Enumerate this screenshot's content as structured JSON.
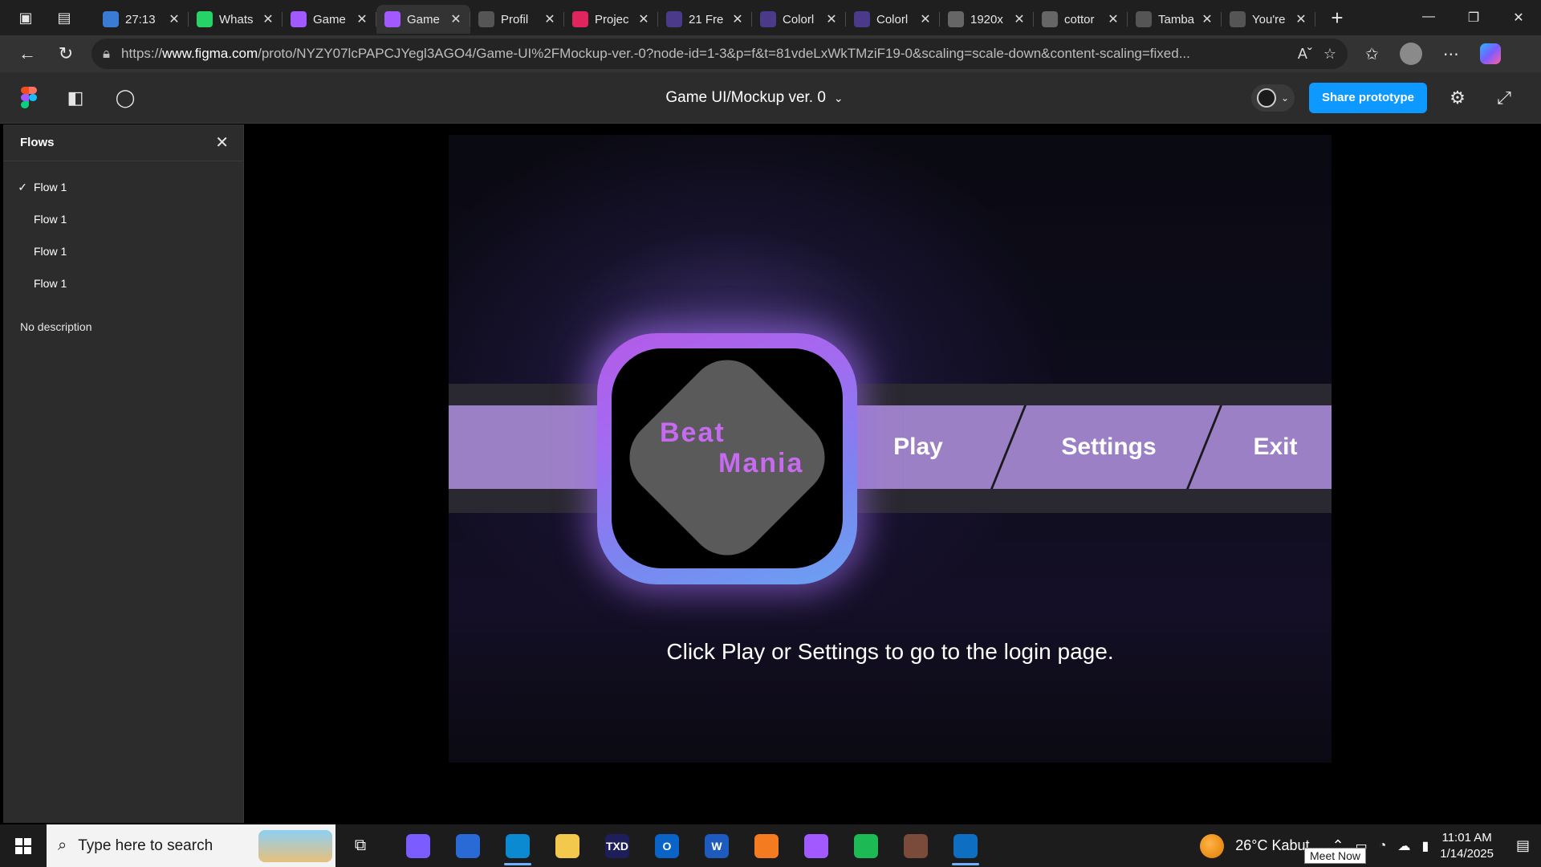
{
  "browser": {
    "tabs": [
      {
        "title": "27:13",
        "fav_color": "#3a7bd5",
        "icon": "timer-icon"
      },
      {
        "title": "Whats",
        "fav_color": "#25d366",
        "icon": "whatsapp-icon"
      },
      {
        "title": "Game",
        "fav_color": "#a259ff",
        "icon": "figma-icon"
      },
      {
        "title": "Game",
        "fav_color": "#a259ff",
        "icon": "figma-icon",
        "active": true
      },
      {
        "title": "Profil",
        "fav_color": "#555555",
        "icon": "globe-icon"
      },
      {
        "title": "Projec",
        "fav_color": "#e0245e",
        "icon": "triangle-icon"
      },
      {
        "title": "21 Fre",
        "fav_color": "#4b3a8a",
        "icon": "site-icon"
      },
      {
        "title": "Colorl",
        "fav_color": "#4b3a8a",
        "icon": "site-icon"
      },
      {
        "title": "Colorl",
        "fav_color": "#4b3a8a",
        "icon": "site-icon"
      },
      {
        "title": "1920x",
        "fav_color": "#666666",
        "icon": "site-icon"
      },
      {
        "title": "cottor",
        "fav_color": "#666666",
        "icon": "site-icon"
      },
      {
        "title": "Tamba",
        "fav_color": "#555555",
        "icon": "openai-icon"
      },
      {
        "title": "You're",
        "fav_color": "#555555",
        "icon": "site-icon"
      }
    ],
    "url_prefix": "https://",
    "url_host": "www.figma.com",
    "url_path": "/proto/NYZY07lcPAPCJYegl3AGO4/Game-UI%2FMockup-ver.-0?node-id=1-3&p=f&t=81vdeLxWkTMziF19-0&scaling=scale-down&content-scaling=fixed..."
  },
  "figma": {
    "file_title": "Game UI/Mockup ver. 0",
    "share_label": "Share prototype"
  },
  "sidebar": {
    "heading": "Flows",
    "flows": [
      "Flow 1",
      "Flow 1",
      "Flow 1",
      "Flow 1"
    ],
    "description": "No description"
  },
  "game": {
    "logo_line1": "Beat",
    "logo_line2": "Mania",
    "menu": [
      "Play",
      "Settings",
      "Exit"
    ],
    "hint": "Click Play or Settings to go to the login page.",
    "colors": {
      "band": "#9c80c6",
      "logo_text": "#c66bf0",
      "accent": "#0d99ff"
    }
  },
  "taskbar": {
    "search_placeholder": "Type here to search",
    "apps": [
      {
        "name": "copilot-app",
        "color": "#7a5cff",
        "label": ""
      },
      {
        "name": "store-app",
        "color": "#2a6ad6",
        "label": ""
      },
      {
        "name": "edge-app",
        "color": "#0c8ad1",
        "label": "",
        "active": true
      },
      {
        "name": "explorer-app",
        "color": "#f2c94c",
        "label": ""
      },
      {
        "name": "txd-app",
        "color": "#1e1e5a",
        "label": "TXD"
      },
      {
        "name": "outlook-app",
        "color": "#0a64c8",
        "label": "O"
      },
      {
        "name": "word-app",
        "color": "#1d5bbf",
        "label": "W"
      },
      {
        "name": "xampp-app",
        "color": "#f57b20",
        "label": ""
      },
      {
        "name": "figma-app",
        "color": "#a259ff",
        "label": ""
      },
      {
        "name": "spotify-app",
        "color": "#1db954",
        "label": ""
      },
      {
        "name": "game-app",
        "color": "#7a4a3a",
        "label": ""
      },
      {
        "name": "vscode-app",
        "color": "#0e6fc2",
        "label": "",
        "active": true
      }
    ],
    "weather": "26°C  Kabut",
    "time": "11:01 AM",
    "date": "1/14/2025",
    "tooltip": "Meet Now"
  }
}
